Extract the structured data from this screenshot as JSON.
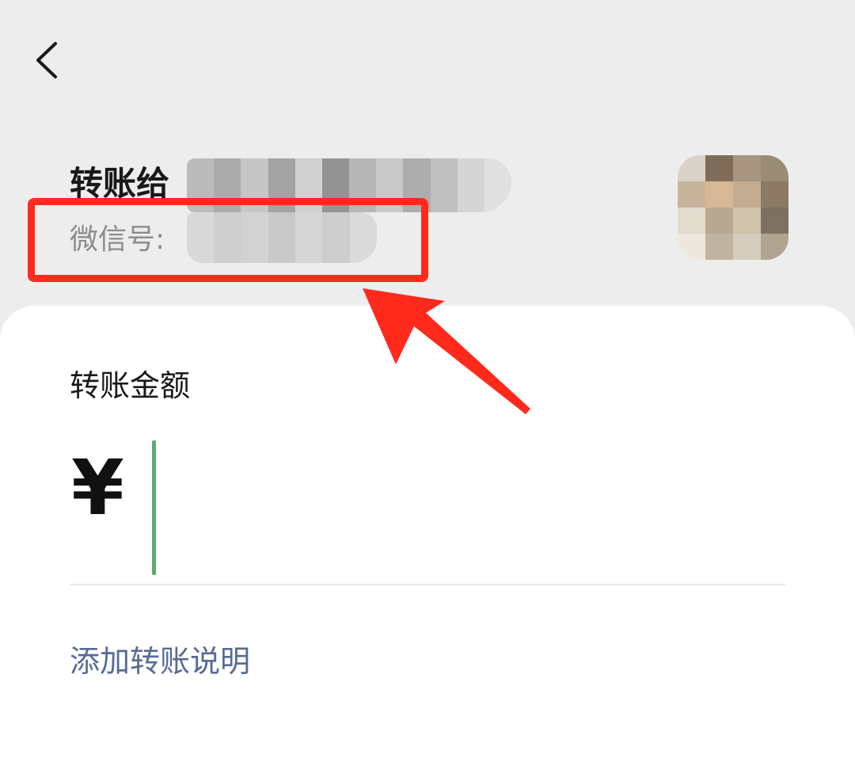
{
  "header": {
    "back_icon": "chevron-left-icon"
  },
  "recipient": {
    "title_prefix": "转账给",
    "wechat_id_label": "微信号:",
    "name_pixels": [
      "#b9b9b9",
      "#a8a8a8",
      "#c4c4c4",
      "#a0a0a0",
      "#cfcfcf",
      "#8f8f8f",
      "#b5b5b5",
      "#c8c8c8",
      "#aaaaaa",
      "#bdbdbd",
      "#d4d4d4",
      "#e0e0e0"
    ],
    "id_pixels": [
      "#d8d8d8",
      "#cfcfcf",
      "#d2d2d2",
      "#c9c9c9",
      "#d6d6d6",
      "#cdcdcd",
      "#dadada"
    ],
    "avatar_pixels": [
      "#d8d2c8",
      "#7e6c58",
      "#a89680",
      "#9a8c74",
      "#c8b49c",
      "#d8b894",
      "#c4ac90",
      "#8c7a66",
      "#e0dccc",
      "#b8a890",
      "#d0c4ac",
      "#7c7060",
      "#ece8de",
      "#c0b4a0",
      "#d4ccbc",
      "#b0a490"
    ]
  },
  "annotation": {
    "highlight_color": "#ff2a1c",
    "arrow_color": "#ff2a1c"
  },
  "transfer": {
    "amount_label": "转账金额",
    "currency_symbol": "¥",
    "amount_value": "",
    "cursor_color": "#5cad6f",
    "add_note_label": "添加转账说明",
    "link_color": "#576b95"
  }
}
